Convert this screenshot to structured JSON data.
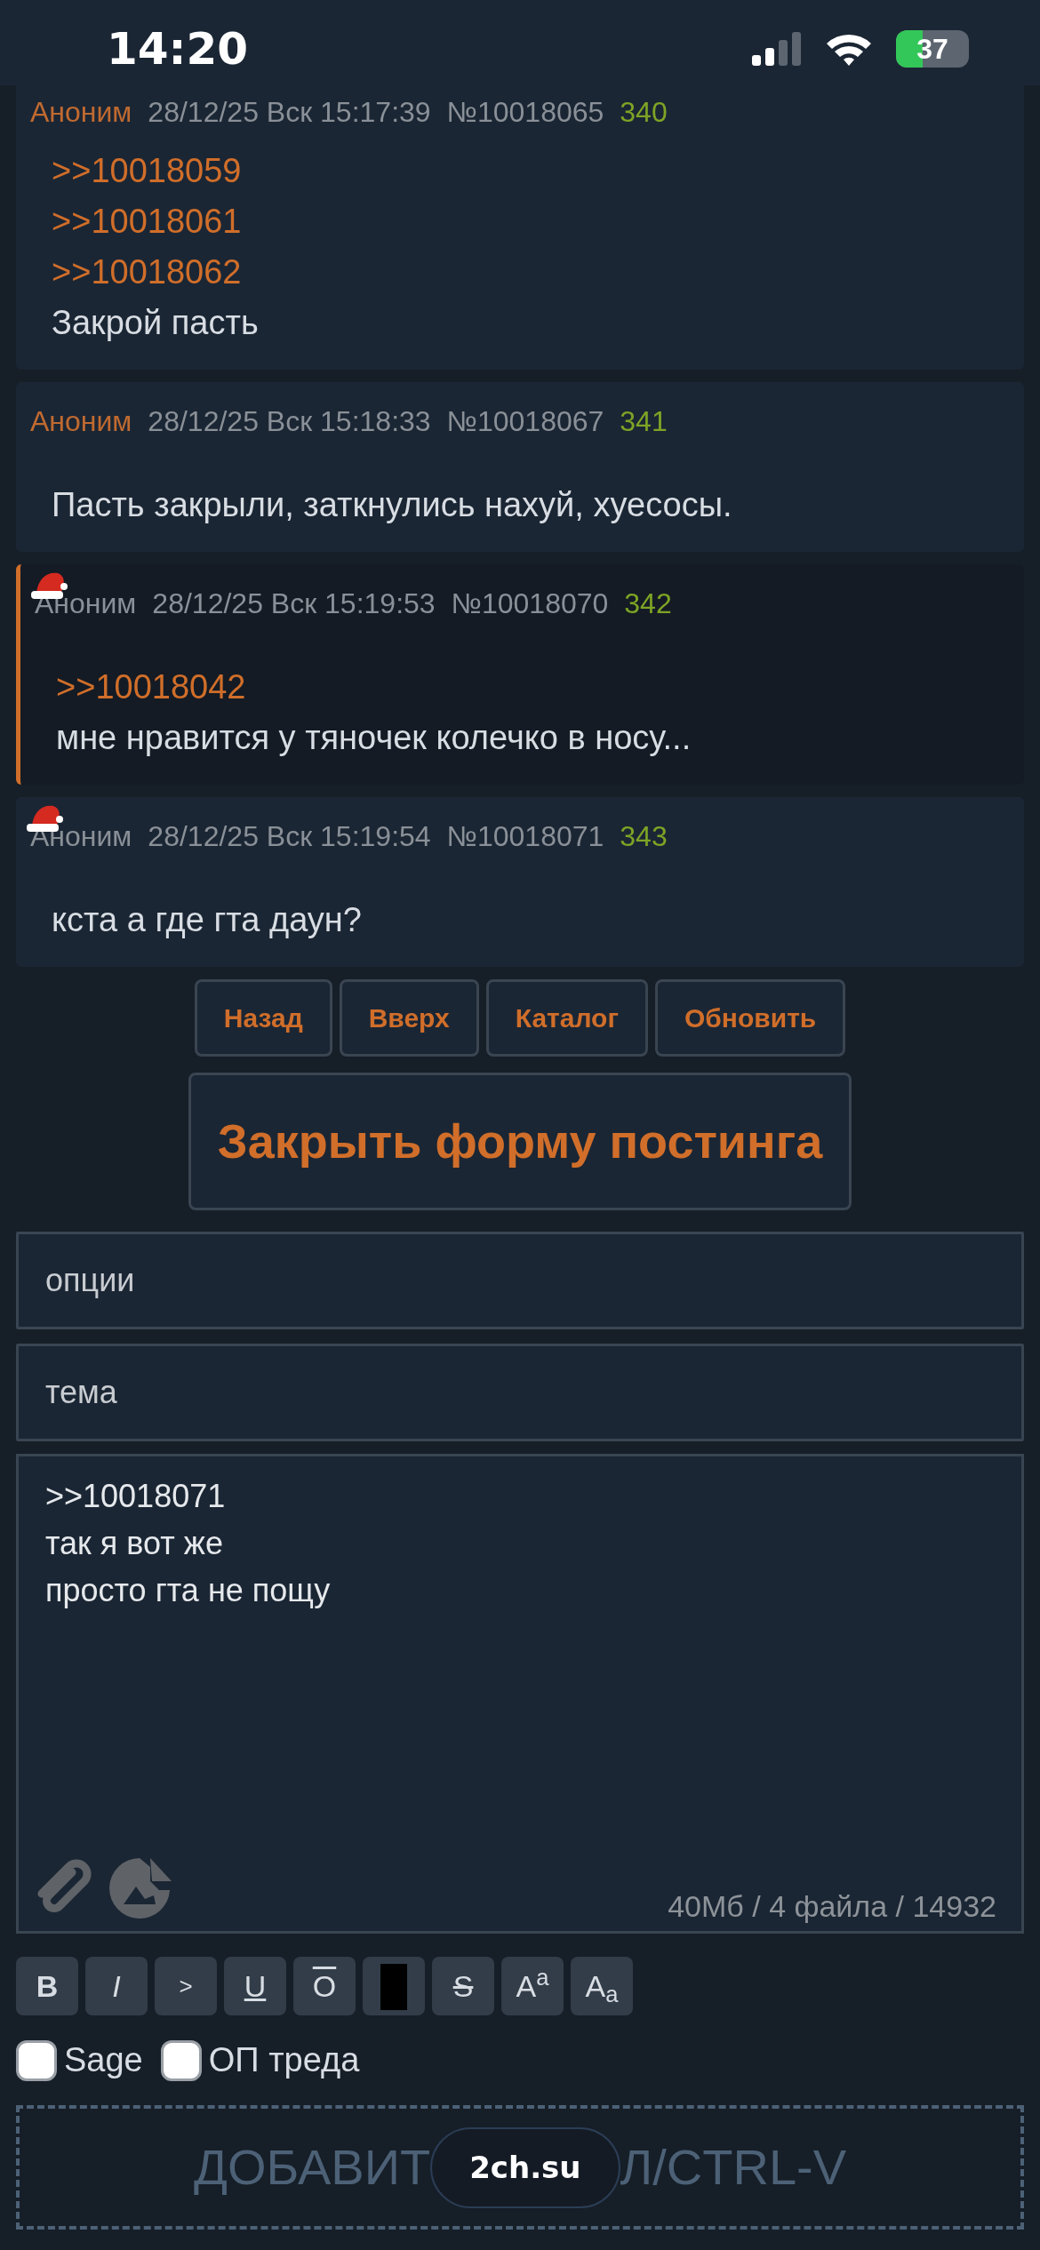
{
  "status_bar": {
    "time": "14:20",
    "battery": "37"
  },
  "posts": [
    {
      "name": "Аноним",
      "date": "28/12/25 Вск 15:17:39",
      "number": "№10018065",
      "count": "340",
      "hat": false,
      "highlighted": false,
      "lines": [
        {
          "kind": "link",
          "text": ">>10018059"
        },
        {
          "kind": "link",
          "text": ">>10018061"
        },
        {
          "kind": "link",
          "text": ">>10018062"
        },
        {
          "kind": "text",
          "text": "Закрой пасть"
        }
      ]
    },
    {
      "name": "Аноним",
      "date": "28/12/25 Вск 15:18:33",
      "number": "№10018067",
      "count": "341",
      "hat": false,
      "highlighted": false,
      "lines": [
        {
          "kind": "text",
          "text": "Пасть закрыли, заткнулись нахуй, хуесосы."
        }
      ]
    },
    {
      "name": "Аноним",
      "date": "28/12/25 Вск 15:19:53",
      "number": "№10018070",
      "count": "342",
      "hat": true,
      "highlighted": true,
      "lines": [
        {
          "kind": "link",
          "text": ">>10018042"
        },
        {
          "kind": "text",
          "text": "мне нравится у тяночек колечко в носу..."
        }
      ]
    },
    {
      "name": "Аноним",
      "date": "28/12/25 Вск 15:19:54",
      "number": "№10018071",
      "count": "343",
      "hat": true,
      "highlighted": false,
      "lines": [
        {
          "kind": "text",
          "text": "кста а где гта даун?"
        }
      ]
    }
  ],
  "nav_buttons": [
    "Назад",
    "Вверх",
    "Каталог",
    "Обновить"
  ],
  "close_form_button": "Закрыть форму постинга",
  "form": {
    "options_placeholder": "опции",
    "subject_placeholder": "тема",
    "message": ">>10018071\nтак я вот же\nпросто гта не пощу",
    "limits": "40Мб / 4 файла / 14932",
    "toolbar": [
      {
        "kind": "bold",
        "label": "B"
      },
      {
        "kind": "italic",
        "label": "I"
      },
      {
        "kind": "quote",
        "label": ">"
      },
      {
        "kind": "underline",
        "label": "U"
      },
      {
        "kind": "overline",
        "label": "O"
      },
      {
        "kind": "spoiler"
      },
      {
        "kind": "strike",
        "label": "S"
      },
      {
        "kind": "sup",
        "label": "A$^{a}$"
      },
      {
        "kind": "sub",
        "label": "A$_{a}$"
      }
    ],
    "checkboxes": [
      {
        "label": "Sage",
        "checked": false
      },
      {
        "label": "ОП треда",
        "checked": false
      }
    ],
    "dropzone_left": "ДОБАВИТ",
    "dropzone_right": "Л/CTRL-V"
  },
  "url_pill": "2ch.su"
}
